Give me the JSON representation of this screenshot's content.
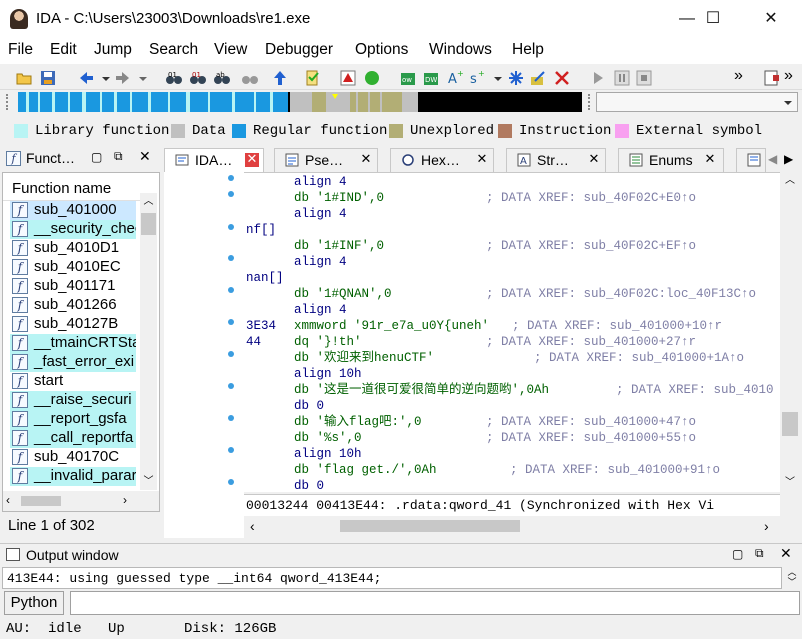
{
  "window": {
    "title": "IDA - C:\\Users\\23003\\Downloads\\re1.exe",
    "controls": {
      "minimize": "—",
      "maximize": "☐",
      "close": "✕"
    }
  },
  "menu": [
    "File",
    "Edit",
    "Jump",
    "Search",
    "View",
    "Debugger",
    "Options",
    "Windows",
    "Help"
  ],
  "toolbar": {
    "overflow": "»"
  },
  "legend": [
    {
      "label": "Library function",
      "color": "#b8f4f4"
    },
    {
      "label": "Data",
      "color": "#c0c0c0"
    },
    {
      "label": "Regular function",
      "color": "#1a98e0"
    },
    {
      "label": "Unexplored",
      "color": "#b2ae75"
    },
    {
      "label": "Instruction",
      "color": "#b17a60"
    },
    {
      "label": "External symbol",
      "color": "#f8a0f0"
    }
  ],
  "functions_panel": {
    "tab_label": "Funct…",
    "header": "Function name",
    "items": [
      "sub_401000",
      "__security_chec",
      "sub_4010D1",
      "sub_4010EC",
      "sub_401171",
      "sub_401266",
      "sub_40127B",
      "__tmainCRTSta",
      "_fast_error_exi",
      "start",
      "__raise_securi",
      "__report_gsfa",
      "__call_reportfa",
      "sub_40170C",
      "__invalid_parar"
    ],
    "line_count": "Line 1 of 302"
  },
  "tabs": [
    {
      "label": "IDA…"
    },
    {
      "label": "Pse…"
    },
    {
      "label": "Hex…"
    },
    {
      "label": "Str…"
    },
    {
      "label": "Enums"
    }
  ],
  "disasm": {
    "lines": [
      {
        "label": "",
        "op": "align 4",
        "cmt": ""
      },
      {
        "label": "",
        "op": "db '1#IND',0",
        "cmt": "; DATA XREF: sub_40F02C+E0↑o"
      },
      {
        "label": "",
        "op": "align 4",
        "cmt": ""
      },
      {
        "label": "nf[]",
        "op": "",
        "cmt": ""
      },
      {
        "label": "",
        "op": "db '1#INF',0",
        "cmt": "; DATA XREF: sub_40F02C+EF↑o"
      },
      {
        "label": "",
        "op": "align 4",
        "cmt": ""
      },
      {
        "label": "nan[]",
        "op": "",
        "cmt": ""
      },
      {
        "label": "",
        "op": "db '1#QNAN',0",
        "cmt": "; DATA XREF: sub_40F02C:loc_40F13C↑o"
      },
      {
        "label": "",
        "op": "align 4",
        "cmt": ""
      },
      {
        "label": "3E34",
        "op": "xmmword '91r_e7a_u0Y{uneh'",
        "cmt": "; DATA XREF: sub_401000+10↑r"
      },
      {
        "label": "44",
        "op": "dq '}!th'",
        "cmt": "; DATA XREF: sub_401000+27↑r"
      },
      {
        "label": "",
        "op": "db '欢迎来到henuCTF'",
        "cmt": "; DATA XREF: sub_401000+1A↑o"
      },
      {
        "label": "",
        "op": "align 10h",
        "cmt": ""
      },
      {
        "label": "",
        "op": "db '这是一道很可爱很简单的逆向题哟',0Ah",
        "cmt": "; DATA XREF: sub_4010"
      },
      {
        "label": "",
        "op": "db 0",
        "cmt": ""
      },
      {
        "label": "",
        "op": "db '输入flag吧:',0",
        "cmt": "; DATA XREF: sub_401000+47↑o"
      },
      {
        "label": "",
        "op": "db '%s',0",
        "cmt": "; DATA XREF: sub_401000+55↑o"
      },
      {
        "label": "",
        "op": "align 10h",
        "cmt": ""
      },
      {
        "label": "",
        "op": "db 'flag get./',0Ah",
        "cmt": "; DATA XREF: sub_401000+91↑o"
      },
      {
        "label": "",
        "op": "db 0",
        "cmt": ""
      }
    ],
    "status": "00013244 00413E44: .rdata:qword_41 (Synchronized with Hex Vi"
  },
  "output": {
    "title": "Output window",
    "text": "413E44: using guessed type __int64 qword_413E44;",
    "prompt_button": "Python",
    "input_value": ""
  },
  "statusbar": {
    "au_label": "AU:",
    "au_value": "idle",
    "direction": "Up",
    "disk": "Disk: 126GB"
  }
}
